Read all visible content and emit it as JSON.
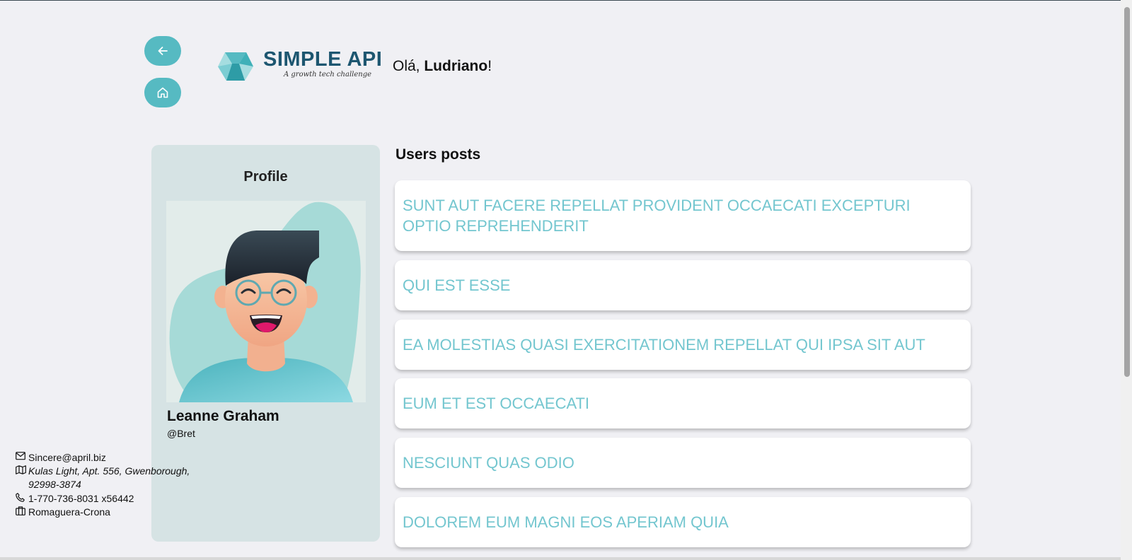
{
  "header": {
    "back_icon": "arrow-left-icon",
    "home_icon": "home-icon",
    "logo": {
      "title": "SIMPLE API",
      "tagline": "A growth tech challenge"
    },
    "greeting": {
      "prefix": "Olá, ",
      "name": "Ludriano",
      "suffix": "!"
    }
  },
  "profile": {
    "title": "Profile",
    "name": "Leanne Graham",
    "username": "@Bret",
    "email": "Sincere@april.biz",
    "address": "Kulas Light, Apt. 556, Gwenborough, 92998-3874",
    "phone": "1-770-736-8031 x56442",
    "company": "Romaguera-Crona",
    "icons": {
      "email": "envelope-icon",
      "address": "map-icon",
      "phone": "phone-icon",
      "company": "briefcase-icon"
    }
  },
  "posts": {
    "heading": "Users posts",
    "items": [
      {
        "title": "SUNT AUT FACERE REPELLAT PROVIDENT OCCAECATI EXCEPTURI OPTIO REPREHENDERIT"
      },
      {
        "title": "QUI EST ESSE"
      },
      {
        "title": "EA MOLESTIAS QUASI EXERCITATIONEM REPELLAT QUI IPSA SIT AUT"
      },
      {
        "title": "EUM ET EST OCCAECATI"
      },
      {
        "title": "NESCIUNT QUAS ODIO"
      },
      {
        "title": "DOLOREM EUM MAGNI EOS APERIAM QUIA"
      }
    ]
  },
  "colors": {
    "accent": "#56bac2",
    "post_title": "#73c6cf",
    "brand_dark": "#1d5670",
    "background": "#f0f0f4",
    "profile_card": "#d6e3e4"
  }
}
